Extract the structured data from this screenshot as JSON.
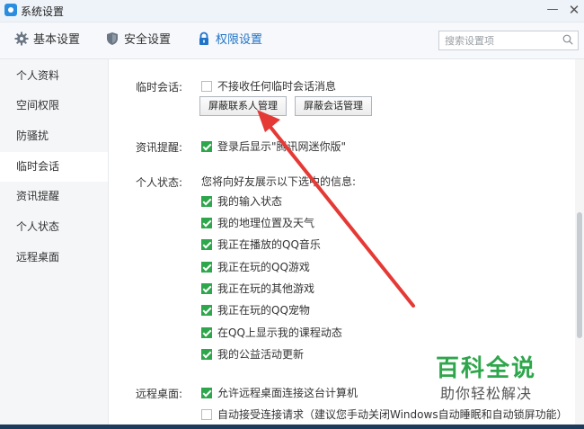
{
  "window": {
    "title": "系统设置",
    "minimize_glyph": "—",
    "close_glyph": "✕"
  },
  "tabs": [
    {
      "label": "基本设置",
      "icon": "gear-icon"
    },
    {
      "label": "安全设置",
      "icon": "shield-icon"
    },
    {
      "label": "权限设置",
      "icon": "lock-icon"
    }
  ],
  "search": {
    "placeholder": "搜索设置项"
  },
  "sidebar": {
    "items": [
      {
        "label": "个人资料"
      },
      {
        "label": "空间权限"
      },
      {
        "label": "防骚扰"
      },
      {
        "label": "临时会话"
      },
      {
        "label": "资讯提醒"
      },
      {
        "label": "个人状态"
      },
      {
        "label": "远程桌面"
      }
    ],
    "active_index": 3
  },
  "temp_session": {
    "label": "临时会话:",
    "checkbox": "不接收任何临时会话消息",
    "checked": false,
    "btn_contacts": "屏蔽联系人管理",
    "btn_sessions": "屏蔽会话管理"
  },
  "news": {
    "label": "资讯提醒:",
    "checkbox": "登录后显示\"腾讯网迷你版\"",
    "checked": true
  },
  "status": {
    "label": "个人状态:",
    "desc": "您将向好友展示以下选中的信息:",
    "items": [
      {
        "text": "我的输入状态",
        "checked": true
      },
      {
        "text": "我的地理位置及天气",
        "checked": true
      },
      {
        "text": "我正在播放的QQ音乐",
        "checked": true
      },
      {
        "text": "我正在玩的QQ游戏",
        "checked": true
      },
      {
        "text": "我正在玩的其他游戏",
        "checked": true
      },
      {
        "text": "我正在玩的QQ宠物",
        "checked": true
      },
      {
        "text": "在QQ上显示我的课程动态",
        "checked": true
      },
      {
        "text": "我的公益活动更新",
        "checked": true
      }
    ]
  },
  "remote": {
    "label": "远程桌面:",
    "allow": "允许远程桌面连接这台计算机",
    "allow_checked": true,
    "auto": "自动接受连接请求（建议您手动关闭Windows自动睡眠和自动锁屏功能）",
    "auto_checked": false
  },
  "watermark": {
    "title": "百科全说",
    "subtitle": "助你轻松解决"
  },
  "colors": {
    "accent": "#1f73c8",
    "check": "#2ea64b",
    "arrow": "#e53935",
    "watermark": "#2ea64b"
  }
}
